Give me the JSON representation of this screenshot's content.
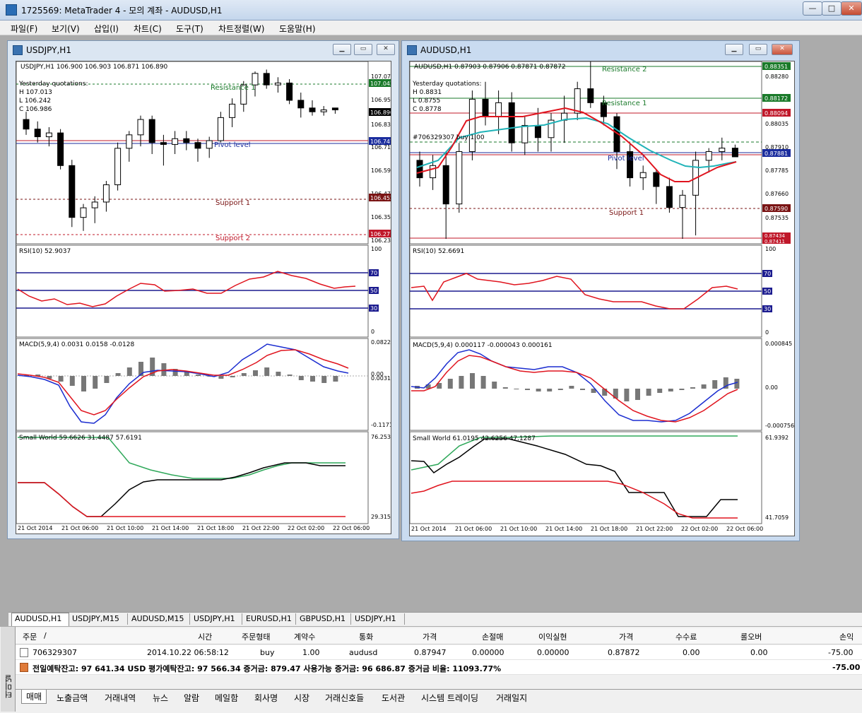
{
  "app": {
    "title": "1725569: MetaTrader 4 - 모의 계좌 - AUDUSD,H1",
    "min": "—",
    "max": "□",
    "close": "✕"
  },
  "menu": [
    "파일(F)",
    "보기(V)",
    "삽입(I)",
    "차트(C)",
    "도구(T)",
    "차트정렬(W)",
    "도움말(H)"
  ],
  "windows": {
    "usdjpy": {
      "title": "USDJPY,H1",
      "header": "USDJPY,H1  106.900 106.903 106.871 106.890",
      "yq": [
        "Yesterday quotations:",
        "H 107.013",
        "L 106.242",
        "C 106.986"
      ],
      "labels": {
        "r1": "Resistance 1",
        "pivot": "Pivot level",
        "s1": "Support 1",
        "s2": "Support 2"
      },
      "price_ticks": [
        "107.070",
        "106.950",
        "106.830",
        "106.710",
        "106.590",
        "106.470",
        "106.350",
        "106.230"
      ],
      "price_tags": [
        {
          "text": "107.042",
          "bg": "#1a7a2a"
        },
        {
          "text": "106.890",
          "bg": "#000000"
        },
        {
          "text": "106.747",
          "bg": "#1b2d9e"
        },
        {
          "text": "106.452",
          "bg": "#7a1414"
        },
        {
          "text": "106.271",
          "bg": "#c0182a"
        }
      ],
      "rsi": {
        "label": "RSI(10) 52.9037",
        "ticks": [
          "100",
          "70",
          "50",
          "30",
          "0"
        ]
      },
      "macd": {
        "label": "MACD(5,9,4) 0.0031 0.0158 -0.0128",
        "ticks": [
          "0.0822",
          "0.00",
          "-0.1171"
        ],
        "zero_extra": "0.0031"
      },
      "sw": {
        "label": "Small World 59.6626 31.4487 57.6191",
        "ticks": [
          "76.2539",
          "29.3151"
        ]
      },
      "time_ticks": [
        "21 Oct 2014",
        "21 Oct 06:00",
        "21 Oct 10:00",
        "21 Oct 14:00",
        "21 Oct 18:00",
        "21 Oct 22:00",
        "22 Oct 02:00",
        "22 Oct 06:00"
      ]
    },
    "audusd": {
      "title": "AUDUSD,H1",
      "header": "AUDUSD,H1  0.87903 0.87906 0.87871 0.87872",
      "yq": [
        "Yesterday quotations:",
        "H 0.8831",
        "L 0.8755",
        "C 0.8778"
      ],
      "order_label": "#706329307 buy 1.00",
      "labels": {
        "r2": "Resistance 2",
        "r1": "Resistance 1",
        "pivot": "Pivot level",
        "s1": "Support 1"
      },
      "price_ticks": [
        "0.88280",
        "0.88155",
        "0.88035",
        "0.87910",
        "0.87785",
        "0.87660",
        "0.87535"
      ],
      "price_tags": [
        {
          "text": "0.88351",
          "bg": "#1a7a2a"
        },
        {
          "text": "0.88172",
          "bg": "#1a7a2a"
        },
        {
          "text": "0.88094",
          "bg": "#c0182a"
        },
        {
          "text": "0.87881",
          "bg": "#1b2d9e"
        },
        {
          "text": "0.87590",
          "bg": "#7a1414"
        },
        {
          "text": "0.87434",
          "bg": "#c0182a"
        },
        {
          "text": "0.87411",
          "bg": "#c0182a"
        }
      ],
      "rsi": {
        "label": "RSI(10) 52.6691",
        "ticks": [
          "100",
          "70",
          "50",
          "30",
          "0"
        ]
      },
      "macd": {
        "label": "MACD(5,9,4) 0.000117 -0.000043 0.000161",
        "ticks": [
          "0.000845",
          "0.00",
          "-0.000756"
        ]
      },
      "sw": {
        "label": "Small World 61.0195 42.6256 47.1287",
        "ticks": [
          "61.9392",
          "41.7059"
        ]
      },
      "time_ticks": [
        "21 Oct 2014",
        "21 Oct 06:00",
        "21 Oct 10:00",
        "21 Oct 14:00",
        "21 Oct 18:00",
        "21 Oct 22:00",
        "22 Oct 02:00",
        "22 Oct 06:00"
      ]
    }
  },
  "chart_tabs": [
    "AUDUSD,H1",
    "USDJPY,M15",
    "AUDUSD,M15",
    "USDJPY,H1",
    "EURUSD,H1",
    "GBPUSD,H1",
    "USDJPY,H1"
  ],
  "terminal": {
    "side_label": "터미널",
    "columns": [
      "주문",
      "/",
      "시간",
      "주문형태",
      "계약수",
      "통화",
      "가격",
      "손절매",
      "이익실현",
      "가격",
      "수수료",
      "롤오버",
      "손익"
    ],
    "order": {
      "ticket": "706329307",
      "time": "2014.10.22 06:58:12",
      "type": "buy",
      "size": "1.00",
      "symbol": "audusd",
      "open": "0.87947",
      "sl": "0.00000",
      "tp": "0.00000",
      "price": "0.87872",
      "commission": "0.00",
      "swap": "0.00",
      "profit": "-75.00"
    },
    "summary": "전일예탁잔고: 97 641.34 USD  평가예탁잔고: 97 566.34  증거금: 879.47  사용가능 증거금: 96 686.87  증거금 비율: 11093.77%",
    "summary_profit": "-75.00",
    "bottom_tabs": [
      "매매",
      "노출금액",
      "거래내역",
      "뉴스",
      "알람",
      "메일함",
      "회사명",
      "시장",
      "거래신호들",
      "도서관",
      "시스템 트레이딩",
      "거래일지"
    ]
  },
  "colors": {
    "bull": "#ffffff",
    "bear": "#000000",
    "ma_fast": "#e0141e",
    "ma_slow": "#1b1b8f",
    "ma_cyan": "#20b3b8",
    "grid": "#ffffff"
  },
  "chart_data": [
    {
      "type": "candlestick",
      "title": "USDJPY,H1",
      "x": [
        "21 Oct 2014",
        "21 Oct 06:00",
        "21 Oct 10:00",
        "21 Oct 14:00",
        "21 Oct 18:00",
        "21 Oct 22:00",
        "22 Oct 02:00",
        "22 Oct 06:00"
      ],
      "ohlc": [
        [
          106.84,
          106.88,
          106.76,
          106.79
        ],
        [
          106.79,
          106.83,
          106.72,
          106.75
        ],
        [
          106.75,
          106.8,
          106.7,
          106.77
        ],
        [
          106.77,
          106.79,
          106.58,
          106.6
        ],
        [
          106.6,
          106.63,
          106.28,
          106.33
        ],
        [
          106.33,
          106.4,
          106.26,
          106.38
        ],
        [
          106.38,
          106.44,
          106.3,
          106.41
        ],
        [
          106.41,
          106.52,
          106.36,
          106.5
        ],
        [
          106.5,
          106.72,
          106.47,
          106.69
        ],
        [
          106.69,
          106.78,
          106.62,
          106.76
        ],
        [
          106.76,
          106.86,
          106.7,
          106.84
        ],
        [
          106.84,
          106.86,
          106.66,
          106.72
        ],
        [
          106.72,
          106.76,
          106.6,
          106.71
        ],
        [
          106.71,
          106.78,
          106.66,
          106.74
        ],
        [
          106.74,
          106.78,
          106.68,
          106.72
        ],
        [
          106.72,
          106.74,
          106.62,
          106.69
        ],
        [
          106.69,
          106.75,
          106.64,
          106.73
        ],
        [
          106.73,
          106.88,
          106.72,
          106.85
        ],
        [
          106.85,
          106.95,
          106.8,
          106.92
        ],
        [
          106.92,
          107.04,
          106.88,
          107.02
        ],
        [
          107.02,
          107.09,
          106.96,
          107.08
        ],
        [
          107.08,
          107.1,
          107.0,
          107.02
        ],
        [
          107.02,
          107.06,
          106.98,
          107.03
        ],
        [
          107.03,
          107.05,
          106.92,
          106.94
        ],
        [
          106.94,
          106.98,
          106.85,
          106.9
        ],
        [
          106.9,
          106.94,
          106.86,
          106.88
        ],
        [
          106.88,
          106.91,
          106.86,
          106.89
        ],
        [
          106.9,
          106.9,
          106.87,
          106.89
        ]
      ]
    },
    {
      "type": "candlestick",
      "title": "AUDUSD,H1",
      "x": [
        "21 Oct 2014",
        "21 Oct 06:00",
        "21 Oct 10:00",
        "21 Oct 14:00",
        "21 Oct 18:00",
        "21 Oct 22:00",
        "22 Oct 02:00",
        "22 Oct 06:00"
      ],
      "ohlc": [
        [
          0.8785,
          0.879,
          0.877,
          0.8775
        ],
        [
          0.8775,
          0.8788,
          0.8768,
          0.8782
        ],
        [
          0.8782,
          0.879,
          0.874,
          0.876
        ],
        [
          0.876,
          0.8795,
          0.8755,
          0.879
        ],
        [
          0.879,
          0.8825,
          0.8785,
          0.882
        ],
        [
          0.882,
          0.883,
          0.8805,
          0.881
        ],
        [
          0.881,
          0.8825,
          0.88,
          0.8818
        ],
        [
          0.8818,
          0.8824,
          0.879,
          0.8795
        ],
        [
          0.8795,
          0.881,
          0.8788,
          0.8805
        ],
        [
          0.8805,
          0.8815,
          0.879,
          0.8798
        ],
        [
          0.8798,
          0.8812,
          0.879,
          0.8808
        ],
        [
          0.8808,
          0.8822,
          0.8795,
          0.8812
        ],
        [
          0.8812,
          0.883,
          0.8808,
          0.8826
        ],
        [
          0.8826,
          0.8845,
          0.8815,
          0.8818
        ],
        [
          0.8818,
          0.8822,
          0.8805,
          0.881
        ],
        [
          0.881,
          0.8812,
          0.878,
          0.879
        ],
        [
          0.879,
          0.8795,
          0.877,
          0.8775
        ],
        [
          0.8775,
          0.8782,
          0.8768,
          0.8778
        ],
        [
          0.8778,
          0.878,
          0.876,
          0.877
        ],
        [
          0.877,
          0.8775,
          0.8755,
          0.8758
        ],
        [
          0.8758,
          0.8768,
          0.874,
          0.8765
        ],
        [
          0.8765,
          0.879,
          0.8742,
          0.8785
        ],
        [
          0.8785,
          0.8792,
          0.8778,
          0.879
        ],
        [
          0.879,
          0.8798,
          0.8785,
          0.8792
        ],
        [
          0.8792,
          0.8794,
          0.8787,
          0.8787
        ]
      ]
    }
  ]
}
